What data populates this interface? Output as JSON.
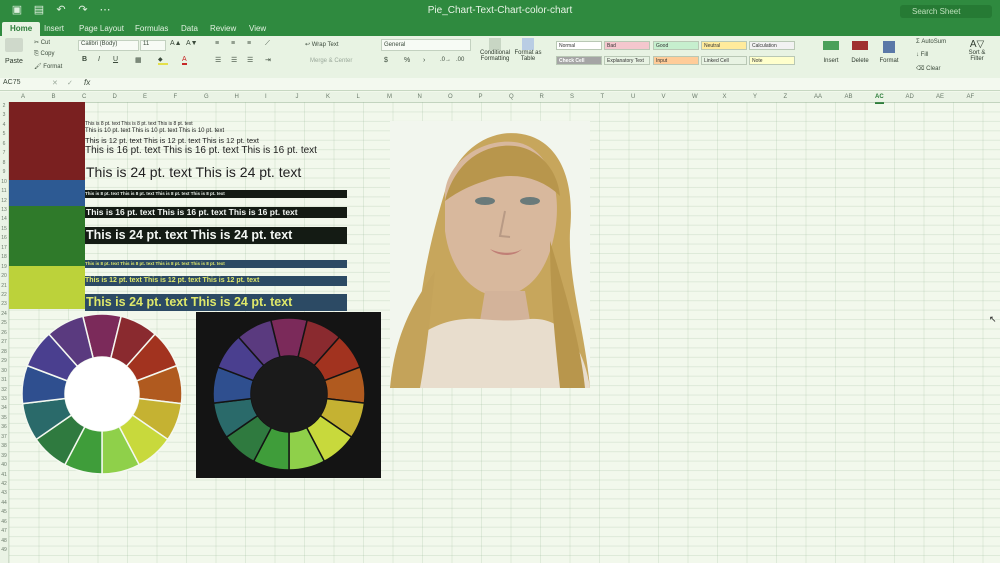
{
  "app": {
    "title": "Pie_Chart-Text-Chart-color-chart",
    "search_placeholder": "Search Sheet"
  },
  "tabs": [
    "Home",
    "Insert",
    "Page Layout",
    "Formulas",
    "Data",
    "Review",
    "View"
  ],
  "ribbon": {
    "paste": "Paste",
    "cut": "Cut",
    "copy": "Copy",
    "format": "Format",
    "font": "Calibri (Body)",
    "font_size": "11",
    "wrap_text": "Wrap Text",
    "merge_center": "Merge & Center",
    "number_format": "General",
    "conditional_formatting": "Conditional Formatting",
    "format_as_table": "Format as Table",
    "insert": "Insert",
    "delete": "Delete",
    "format_cells": "Format",
    "autosum": "AutoSum",
    "fill": "Fill",
    "clear": "Clear",
    "sort_filter": "Sort & Filter",
    "styles": [
      {
        "label": "Normal",
        "bg": "#ffffff"
      },
      {
        "label": "Bad",
        "bg": "#f4c7ce"
      },
      {
        "label": "Good",
        "bg": "#c6efce"
      },
      {
        "label": "Neutral",
        "bg": "#ffeb9c"
      },
      {
        "label": "Calculation",
        "bg": "#f2f2f2"
      },
      {
        "label": "Check Cell",
        "bg": "#a5a5a5"
      },
      {
        "label": "Explanatory Text",
        "bg": "#e8f3e3"
      },
      {
        "label": "Input",
        "bg": "#ffcc99"
      },
      {
        "label": "Linked Cell",
        "bg": "#e8f3e3"
      },
      {
        "label": "Note",
        "bg": "#ffffcc"
      }
    ]
  },
  "formula_bar": {
    "cell_ref": "AC75",
    "fx": "fx"
  },
  "columns": [
    "A",
    "B",
    "C",
    "D",
    "E",
    "F",
    "G",
    "H",
    "I",
    "J",
    "K",
    "L",
    "M",
    "N",
    "O",
    "P",
    "Q",
    "R",
    "S",
    "T",
    "U",
    "V",
    "W",
    "X",
    "Y",
    "Z",
    "AA",
    "AB",
    "AC",
    "AD",
    "AE",
    "AF"
  ],
  "rows": [
    "2",
    "3",
    "4",
    "5",
    "6",
    "7",
    "8",
    "9",
    "10",
    "11",
    "12",
    "13",
    "14",
    "15",
    "16",
    "17",
    "18",
    "19",
    "20",
    "21",
    "22",
    "23",
    "24",
    "25",
    "26",
    "27",
    "28",
    "29",
    "30",
    "31",
    "32",
    "33",
    "34",
    "35",
    "36",
    "37",
    "38",
    "39",
    "40",
    "41",
    "42",
    "43",
    "44",
    "45",
    "46",
    "47",
    "48",
    "49"
  ],
  "swatches": [
    {
      "color": "#7a2020"
    },
    {
      "color": "#2d5a93"
    },
    {
      "color": "#2f7a2a"
    },
    {
      "color": "#bcd23a"
    }
  ],
  "text_samples": {
    "red_section": [
      "This is 8 pt. text   This is 8 pt. text   This is 8 pt. text",
      "This is 10 pt. text   This is 10 pt. text   This is 10 pt. text",
      "This is 12 pt. text   This is 12 pt. text   This is 12 pt. text",
      "This is 16 pt. text   This is 16 pt. text   This is 16 pt. text",
      "This is 24 pt. text   This is 24 pt. text"
    ],
    "blue_section": [
      "This is 8 pt. text   This is 8 pt. text   This is 8 pt. text   This is 8 pt. text",
      "This is 16 pt. text   This is 16 pt. text   This is 16 pt. text",
      "This is 24 pt. text   This is 24 pt. text"
    ],
    "yellow_section": [
      "This is 8 pt. text   This is 8 pt. text   This is 8 pt. text   This is 8 pt. text",
      "This is 12 pt. text   This is 12 pt. text   This is 12 pt. text",
      "This is 24 pt. text   This is 24 pt. text"
    ]
  },
  "color_wheel": {
    "segments": [
      "#7b2a5a",
      "#8a2a2f",
      "#a2331f",
      "#b05a1f",
      "#c5b232",
      "#c8d93c",
      "#8fd04a",
      "#3f9d3a",
      "#2f7a3f",
      "#2a6a6a",
      "#2f4f8f",
      "#4a3f8f",
      "#5a3a7f"
    ]
  }
}
